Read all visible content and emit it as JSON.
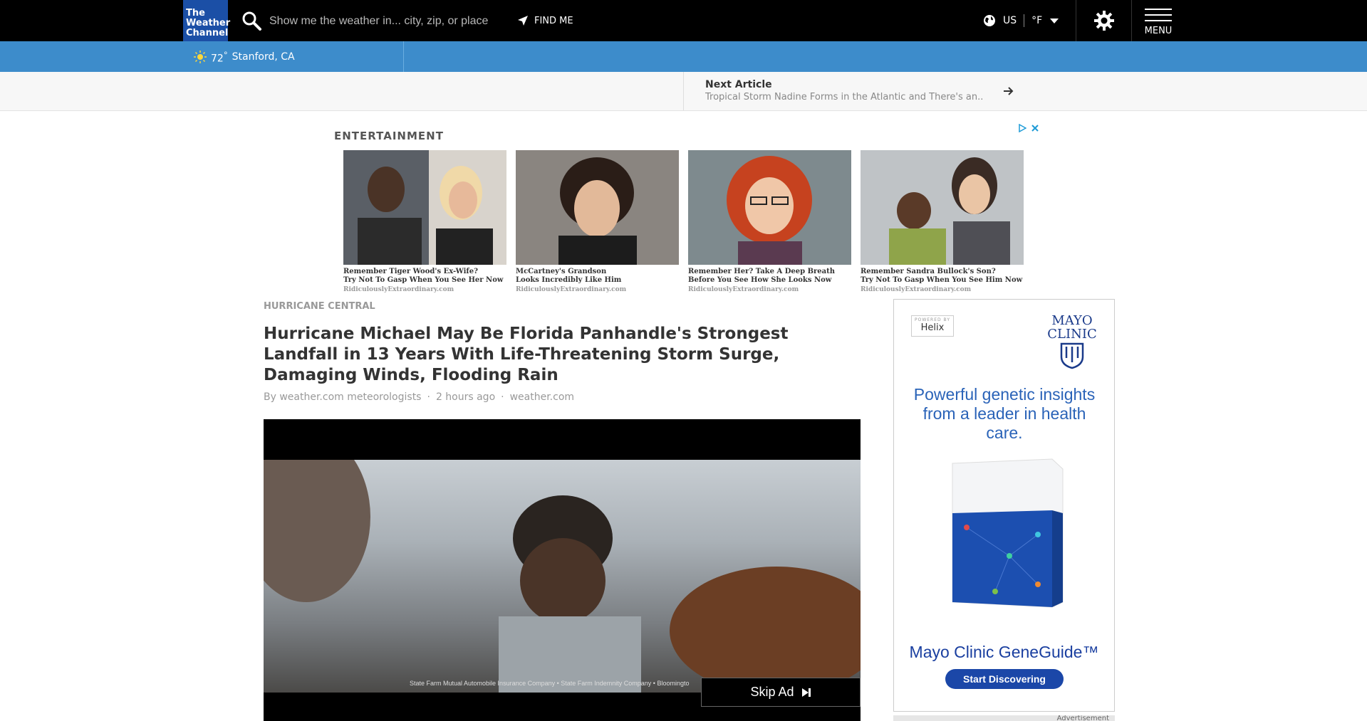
{
  "header": {
    "logo": [
      "The",
      "Weather",
      "Channel"
    ],
    "search_placeholder": "Show me the weather in... city, zip, or place",
    "find_me": "FIND ME",
    "country": "US",
    "unit": "°F",
    "menu": "MENU"
  },
  "location_bar": {
    "temp": "72",
    "degree": "°",
    "place": "Stanford, CA"
  },
  "next_article": {
    "label": "Next Article",
    "title": "Tropical Storm Nadine Forms in the Atlantic and There's an..."
  },
  "entertainment": {
    "label": "ENTERTAINMENT",
    "cards": [
      {
        "line1": "Remember Tiger Wood's Ex-Wife?",
        "line2": "Try Not To Gasp When You See Her Now",
        "source": "RidiculouslyExtraordinary.com"
      },
      {
        "line1": "McCartney's Grandson",
        "line2": "Looks Incredibly Like Him",
        "source": "RidiculouslyExtraordinary.com"
      },
      {
        "line1": "Remember Her? Take A Deep Breath",
        "line2": "Before You See How She Looks Now",
        "source": "RidiculouslyExtraordinary.com"
      },
      {
        "line1": "Remember Sandra Bullock's Son?",
        "line2": "Try Not To Gasp When You See Him Now",
        "source": "RidiculouslyExtraordinary.com"
      }
    ]
  },
  "article": {
    "kicker": "HURRICANE CENTRAL",
    "headline": "Hurricane Michael May Be Florida Panhandle's Strongest Landfall in 13 Years With Life-Threatening Storm Surge, Damaging Winds, Flooding Rain",
    "byline": {
      "author": "By weather.com meteorologists",
      "time": "2 hours ago",
      "source": "weather.com",
      "dot": "·"
    }
  },
  "video": {
    "caption": "State Farm Mutual Automobile Insurance Company • State Farm Indemnity Company • Bloomingto",
    "skip_label": "Skip Ad"
  },
  "side_ad": {
    "powered_by": "POWERED BY",
    "helix": "Helix",
    "brand_line1": "MAYO",
    "brand_line2": "CLINIC",
    "headline": "Powerful genetic insights from a leader in health care.",
    "product": "Mayo Clinic GeneGuide™",
    "cta": "Start Discovering",
    "label": "Advertisement"
  },
  "colors": {
    "topbar": "#000000",
    "logo_bg": "#1b4fa6",
    "location_bar": "#3d8ccb",
    "ad_blue": "#2a63b8"
  }
}
